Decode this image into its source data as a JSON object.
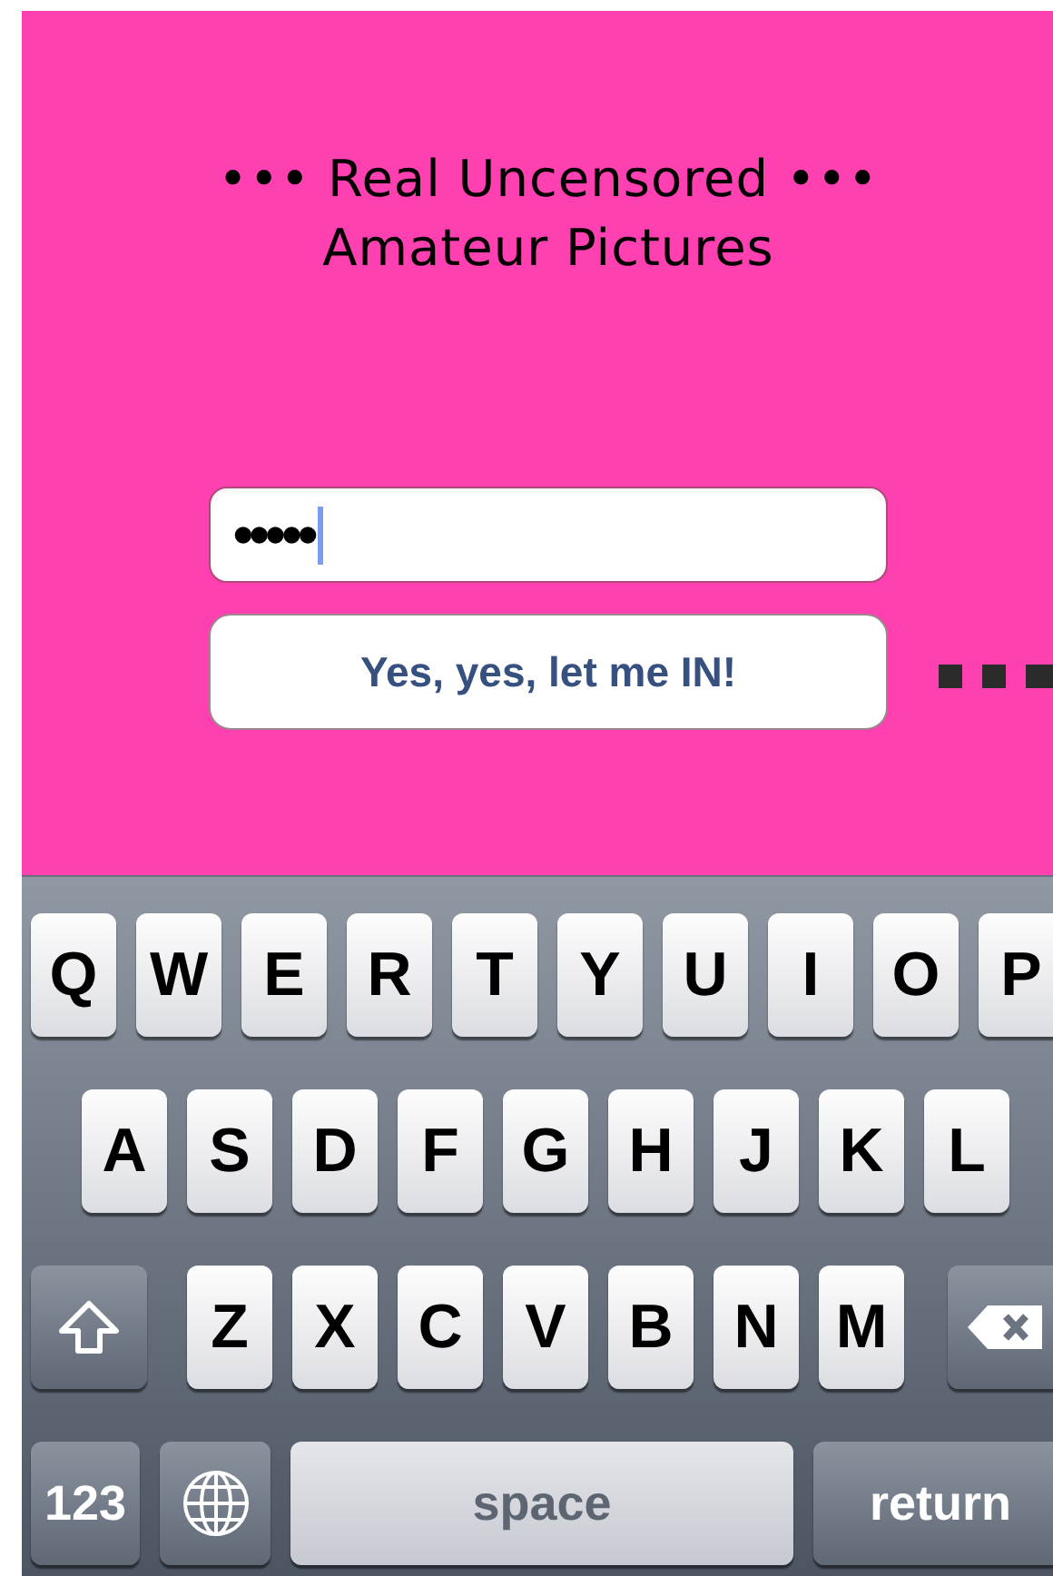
{
  "title": {
    "lines": [
      "••• Real Uncensored •••",
      "Amateur Pictures"
    ]
  },
  "password_field": {
    "value": "•••••"
  },
  "submit_button": {
    "label": "Yes, yes, let me IN!"
  },
  "keyboard": {
    "rows": [
      {
        "keys": [
          {
            "kind": "letter",
            "label": "Q"
          },
          {
            "kind": "letter",
            "label": "W"
          },
          {
            "kind": "letter",
            "label": "E"
          },
          {
            "kind": "letter",
            "label": "R"
          },
          {
            "kind": "letter",
            "label": "T"
          },
          {
            "kind": "letter",
            "label": "Y"
          },
          {
            "kind": "letter",
            "label": "U"
          },
          {
            "kind": "letter",
            "label": "I"
          },
          {
            "kind": "letter",
            "label": "O"
          },
          {
            "kind": "letter",
            "label": "P"
          }
        ]
      },
      {
        "keys": [
          {
            "kind": "letter",
            "label": "A"
          },
          {
            "kind": "letter",
            "label": "S"
          },
          {
            "kind": "letter",
            "label": "D"
          },
          {
            "kind": "letter",
            "label": "F"
          },
          {
            "kind": "letter",
            "label": "G"
          },
          {
            "kind": "letter",
            "label": "H"
          },
          {
            "kind": "letter",
            "label": "J"
          },
          {
            "kind": "letter",
            "label": "K"
          },
          {
            "kind": "letter",
            "label": "L"
          }
        ]
      },
      {
        "keys": [
          {
            "kind": "shift"
          },
          {
            "kind": "letter",
            "label": "Z"
          },
          {
            "kind": "letter",
            "label": "X"
          },
          {
            "kind": "letter",
            "label": "C"
          },
          {
            "kind": "letter",
            "label": "V"
          },
          {
            "kind": "letter",
            "label": "B"
          },
          {
            "kind": "letter",
            "label": "N"
          },
          {
            "kind": "letter",
            "label": "M"
          },
          {
            "kind": "delete"
          }
        ]
      },
      {
        "keys": [
          {
            "kind": "numbers",
            "label": "123"
          },
          {
            "kind": "globe"
          },
          {
            "kind": "space",
            "label": "space"
          },
          {
            "kind": "return",
            "label": "return"
          }
        ]
      }
    ]
  }
}
